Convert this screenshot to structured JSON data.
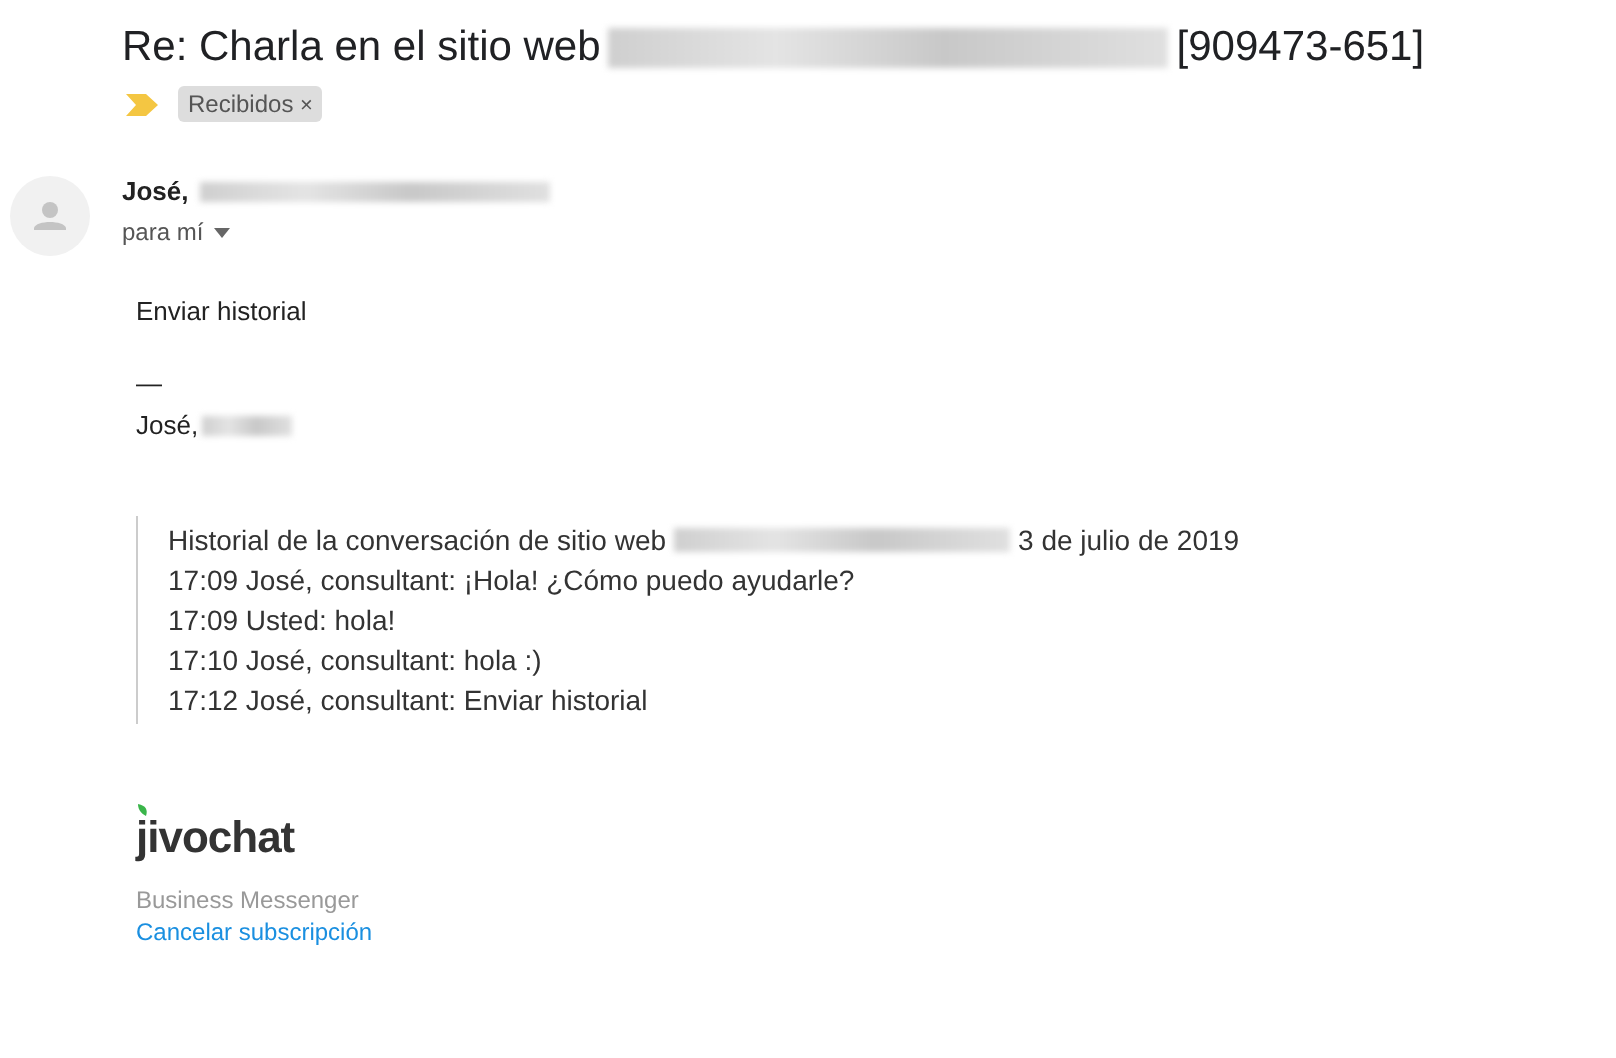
{
  "subject": {
    "text": "Re: Charla en el sitio web",
    "ticket": "[909473-651]"
  },
  "labels": [
    {
      "text": "Recibidos",
      "remove": "×"
    }
  ],
  "sender": {
    "name": "José,",
    "recipient": "para mí"
  },
  "body": {
    "message": "Enviar historial",
    "separator": "—",
    "signature": "José,"
  },
  "history": {
    "heading": "Historial de la conversación de sitio web",
    "date": "3 de julio de 2019",
    "lines": [
      "17:09 José, consultant: ¡Hola! ¿Cómo puedo ayudarle?",
      "17:09 Usted: hola!",
      "17:10 José, consultant: hola :)",
      "17:12 José, consultant: Enviar historial"
    ]
  },
  "footer": {
    "logo": "jivochat",
    "tagline": "Business Messenger",
    "unsubscribe": "Cancelar subscripción"
  }
}
